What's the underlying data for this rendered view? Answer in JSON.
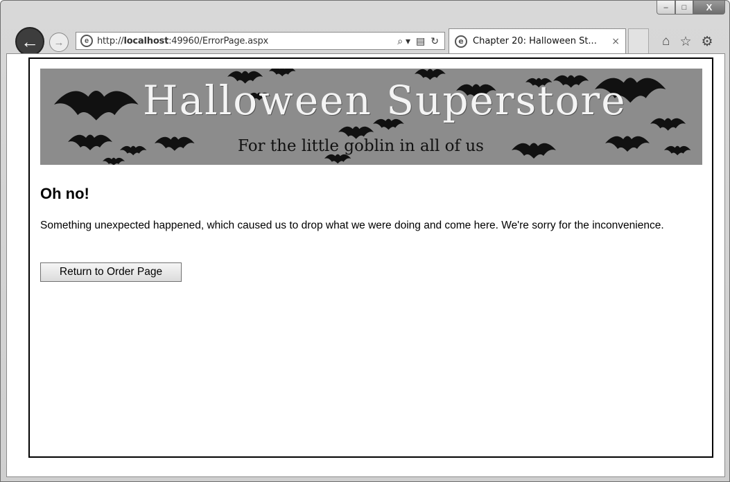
{
  "browser": {
    "address_url_prefix": "http://",
    "address_url_host": "localhost",
    "address_url_rest": ":49960/ErrorPage.aspx",
    "search_glyph": "⌕ ▾",
    "tab_title": "Chapter 20: Halloween St...",
    "tab_close": "×",
    "back_glyph": "←",
    "forward_glyph": "→",
    "ie_glyph": "e",
    "icons": [
      "home-icon",
      "favorites-star-icon",
      "settings-gear-icon"
    ]
  },
  "window_controls": {
    "minimize": "–",
    "maximize": "□",
    "close": "X"
  },
  "banner": {
    "title": "Halloween Superstore",
    "tagline": "For the little goblin in all of us"
  },
  "page": {
    "heading": "Oh no!",
    "message": "Something unexpected happened, which caused us to drop what we were doing and come here. We're sorry for the inconvenience.",
    "button_label": "Return to Order Page"
  },
  "colors": {
    "banner_bg": "#8c8c8c",
    "frame": "#d0d0d0"
  }
}
